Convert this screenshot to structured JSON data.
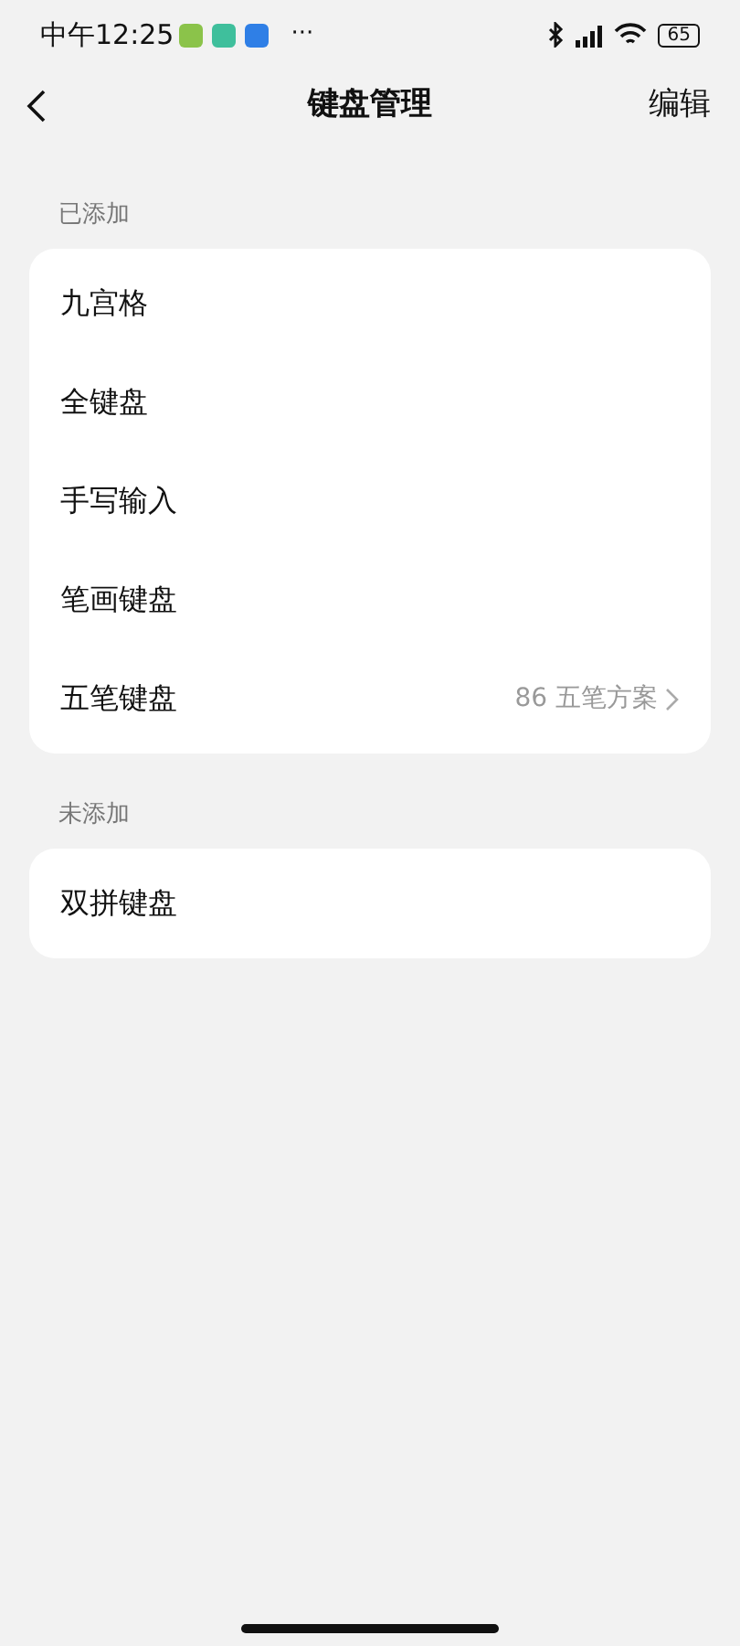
{
  "status_bar": {
    "time": "中午12:25",
    "more": "···",
    "battery": "65"
  },
  "nav": {
    "title": "键盘管理",
    "action": "编辑"
  },
  "sections": [
    {
      "header": "已添加",
      "items": [
        {
          "label": "九宫格"
        },
        {
          "label": "全键盘"
        },
        {
          "label": "手写输入"
        },
        {
          "label": "笔画键盘"
        },
        {
          "label": "五笔键盘",
          "value": "86 五笔方案"
        }
      ]
    },
    {
      "header": "未添加",
      "items": [
        {
          "label": "双拼键盘"
        }
      ]
    }
  ]
}
